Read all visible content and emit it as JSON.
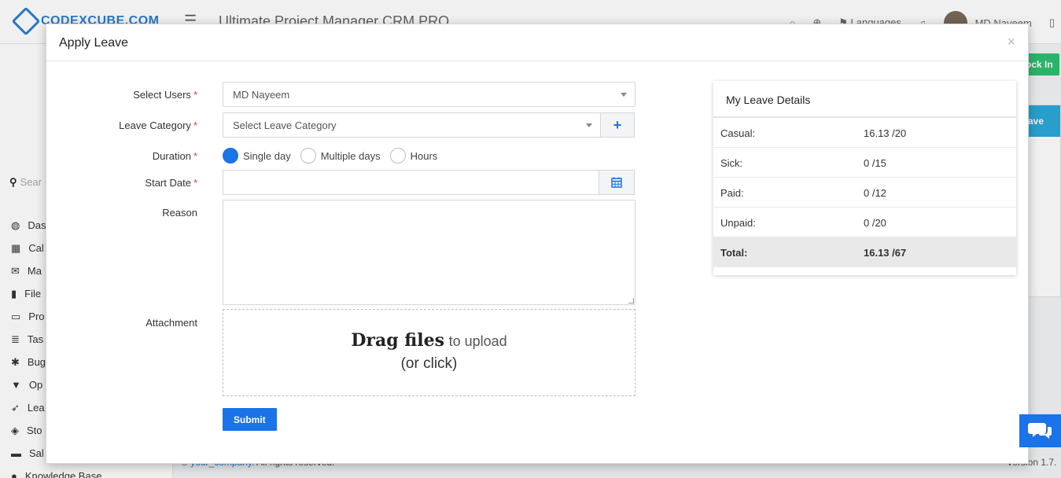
{
  "header": {
    "brand": "CODEXCUBE.COM",
    "app_title": "Ultimate Project Manager CRM PRO",
    "languages_label": "Languages",
    "user_name": "MD Nayeem",
    "clock_in_label": "ock In"
  },
  "background_panel": {
    "header_label": "ave"
  },
  "sidebar": {
    "search_placeholder": "Sear",
    "items": [
      {
        "icon": "dashboard-icon",
        "label": "Das"
      },
      {
        "icon": "calendar-icon",
        "label": "Cal"
      },
      {
        "icon": "envelope-icon",
        "label": "Ma"
      },
      {
        "icon": "file-icon",
        "label": "File"
      },
      {
        "icon": "folder-icon",
        "label": "Pro"
      },
      {
        "icon": "tasks-icon",
        "label": "Tas"
      },
      {
        "icon": "bug-icon",
        "label": "Bug"
      },
      {
        "icon": "filter-icon",
        "label": "Op"
      },
      {
        "icon": "rocket-icon",
        "label": "Lea"
      },
      {
        "icon": "layers-icon",
        "label": "Sto"
      },
      {
        "icon": "cart-icon",
        "label": "Sal"
      },
      {
        "icon": "question-icon",
        "label": "Knowledge Base"
      }
    ]
  },
  "footer": {
    "copyright_symbol": "©",
    "company_link": "your_company",
    "rights": ". All rights reserved.",
    "version": "Version 1.7."
  },
  "modal": {
    "title": "Apply Leave",
    "close": "×",
    "form": {
      "select_users_label": "Select Users",
      "select_users_value": "MD Nayeem",
      "leave_category_label": "Leave Category",
      "leave_category_placeholder": "Select Leave Category",
      "add_category": "+",
      "duration_label": "Duration",
      "duration_options": [
        "Single day",
        "Multiple days",
        "Hours"
      ],
      "duration_selected": "Single day",
      "start_date_label": "Start Date",
      "start_date_value": "",
      "reason_label": "Reason",
      "reason_value": "",
      "attachment_label": "Attachment",
      "dropzone_bold": "Drag files",
      "dropzone_rest": "to upload",
      "dropzone_line2": "(or click)",
      "required_mark": "*",
      "submit_label": "Submit"
    },
    "leave_details": {
      "title": "My Leave Details",
      "rows": [
        {
          "label": "Casual:",
          "value": "16.13 /20"
        },
        {
          "label": "Sick:",
          "value": "0 /15"
        },
        {
          "label": "Paid:",
          "value": "0 /12"
        },
        {
          "label": "Unpaid:",
          "value": "0 /20"
        }
      ],
      "total": {
        "label": "Total:",
        "value": "16.13 /67"
      }
    }
  },
  "colors": {
    "primary": "#1a73e8",
    "clock_in": "#2fbf71",
    "required": "#e53935"
  }
}
